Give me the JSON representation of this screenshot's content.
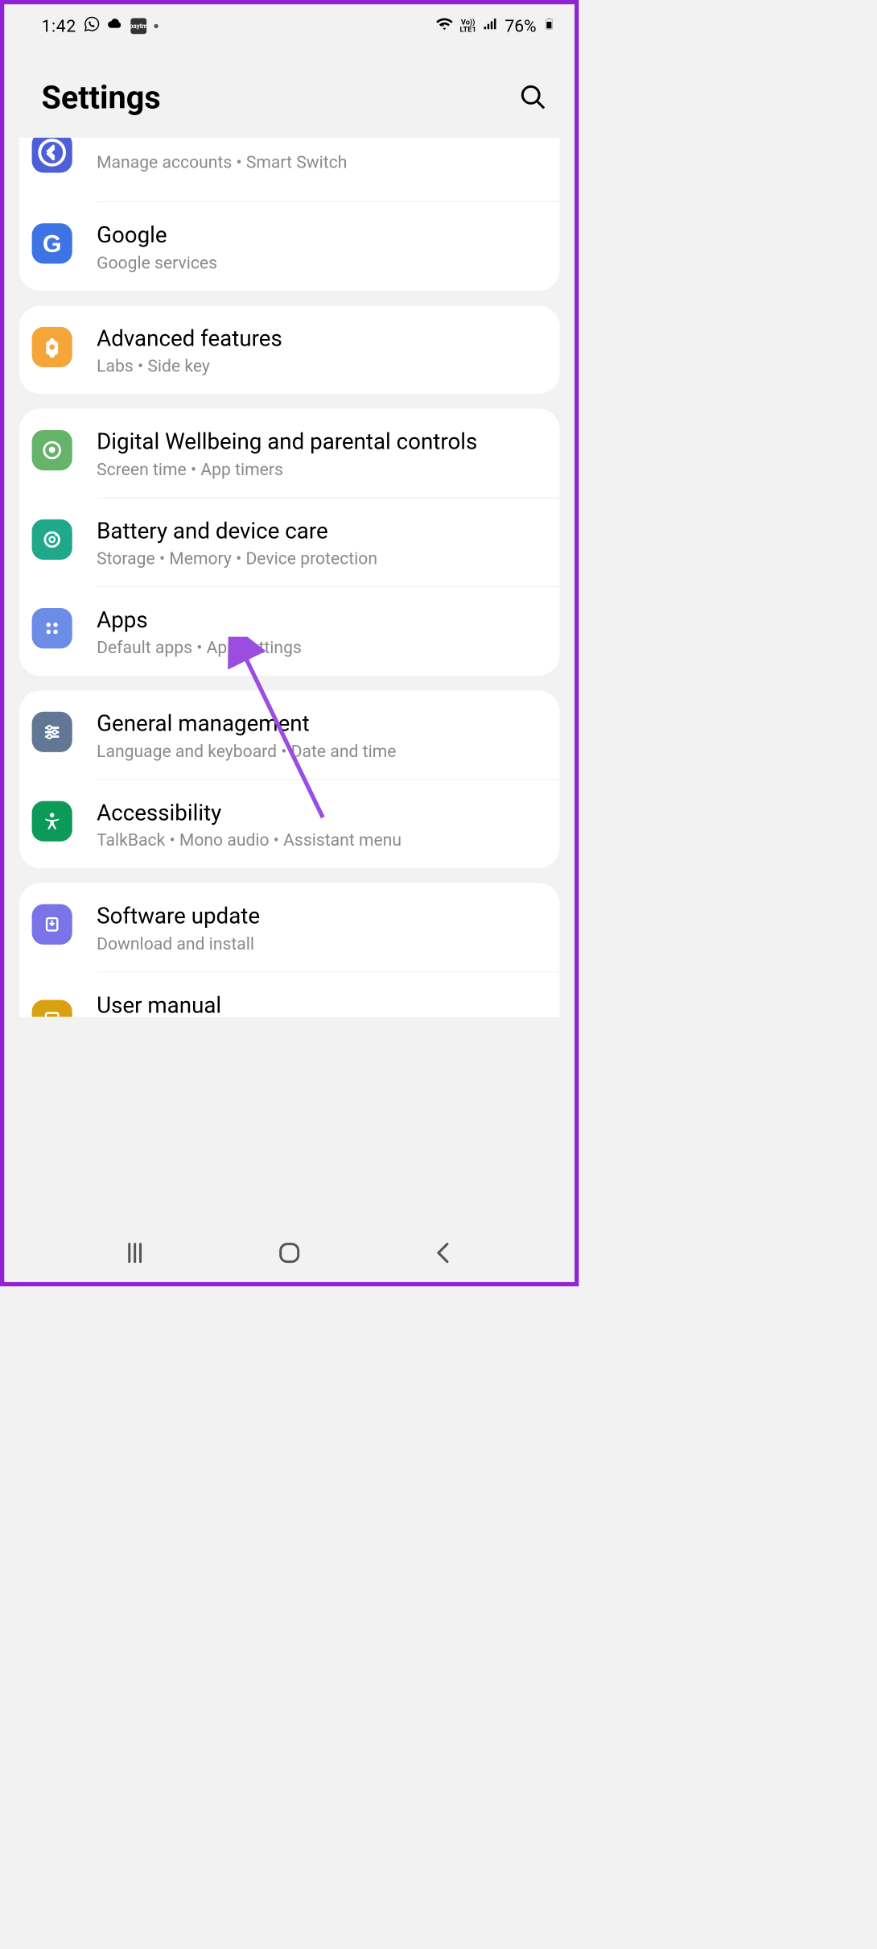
{
  "status": {
    "time": "1:42",
    "battery": "76%"
  },
  "header": {
    "title": "Settings"
  },
  "sections": [
    {
      "items": [
        {
          "title": "",
          "sub": "Manage accounts  •  Smart Switch",
          "icon_color": "#4d60d8"
        },
        {
          "title": "Google",
          "sub": "Google services",
          "icon_color": "#3e73e6"
        }
      ]
    },
    {
      "items": [
        {
          "title": "Advanced features",
          "sub": "Labs  •  Side key",
          "icon_color": "#f5a638"
        }
      ]
    },
    {
      "items": [
        {
          "title": "Digital Wellbeing and parental controls",
          "sub": "Screen time  •  App timers",
          "icon_color": "#66b36a"
        },
        {
          "title": "Battery and device care",
          "sub": "Storage  •  Memory  •  Device protection",
          "icon_color": "#1fa88a"
        },
        {
          "title": "Apps",
          "sub": "Default apps  •  App settings",
          "icon_color": "#6b8de8"
        }
      ]
    },
    {
      "items": [
        {
          "title": "General management",
          "sub": "Language and keyboard  •  Date and time",
          "icon_color": "#617793"
        },
        {
          "title": "Accessibility",
          "sub": "TalkBack  •  Mono audio  •  Assistant menu",
          "icon_color": "#0b9a58"
        }
      ]
    },
    {
      "items": [
        {
          "title": "Software update",
          "sub": "Download and install",
          "icon_color": "#7a74e8"
        },
        {
          "title": "User manual",
          "sub": "",
          "icon_color": "#d9a012"
        }
      ]
    }
  ]
}
